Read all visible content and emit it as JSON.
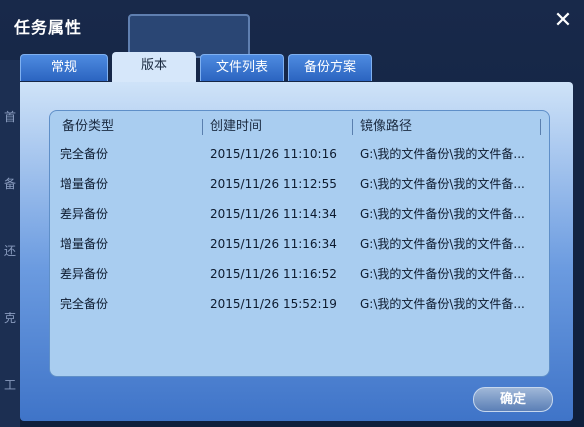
{
  "dialog": {
    "title": "任务属性",
    "close_glyph": "✕"
  },
  "background": {
    "side_labels": [
      "首",
      "备",
      "还",
      "克",
      "工"
    ]
  },
  "tabs": [
    {
      "label": "常规",
      "active": false
    },
    {
      "label": "版本",
      "active": true
    },
    {
      "label": "文件列表",
      "active": false
    },
    {
      "label": "备份方案",
      "active": false
    }
  ],
  "table": {
    "columns": [
      "备份类型",
      "创建时间",
      "镜像路径"
    ],
    "rows": [
      [
        "完全备份",
        "2015/11/26 11:10:16",
        "G:\\我的文件备份\\我的文件备..."
      ],
      [
        "增量备份",
        "2015/11/26 11:12:55",
        "G:\\我的文件备份\\我的文件备..."
      ],
      [
        "差异备份",
        "2015/11/26 11:14:34",
        "G:\\我的文件备份\\我的文件备..."
      ],
      [
        "增量备份",
        "2015/11/26 11:16:34",
        "G:\\我的文件备份\\我的文件备..."
      ],
      [
        "差异备份",
        "2015/11/26 11:16:52",
        "G:\\我的文件备份\\我的文件备..."
      ],
      [
        "完全备份",
        "2015/11/26 15:52:19",
        "G:\\我的文件备份\\我的文件备..."
      ]
    ]
  },
  "buttons": {
    "ok_label": "确定"
  }
}
